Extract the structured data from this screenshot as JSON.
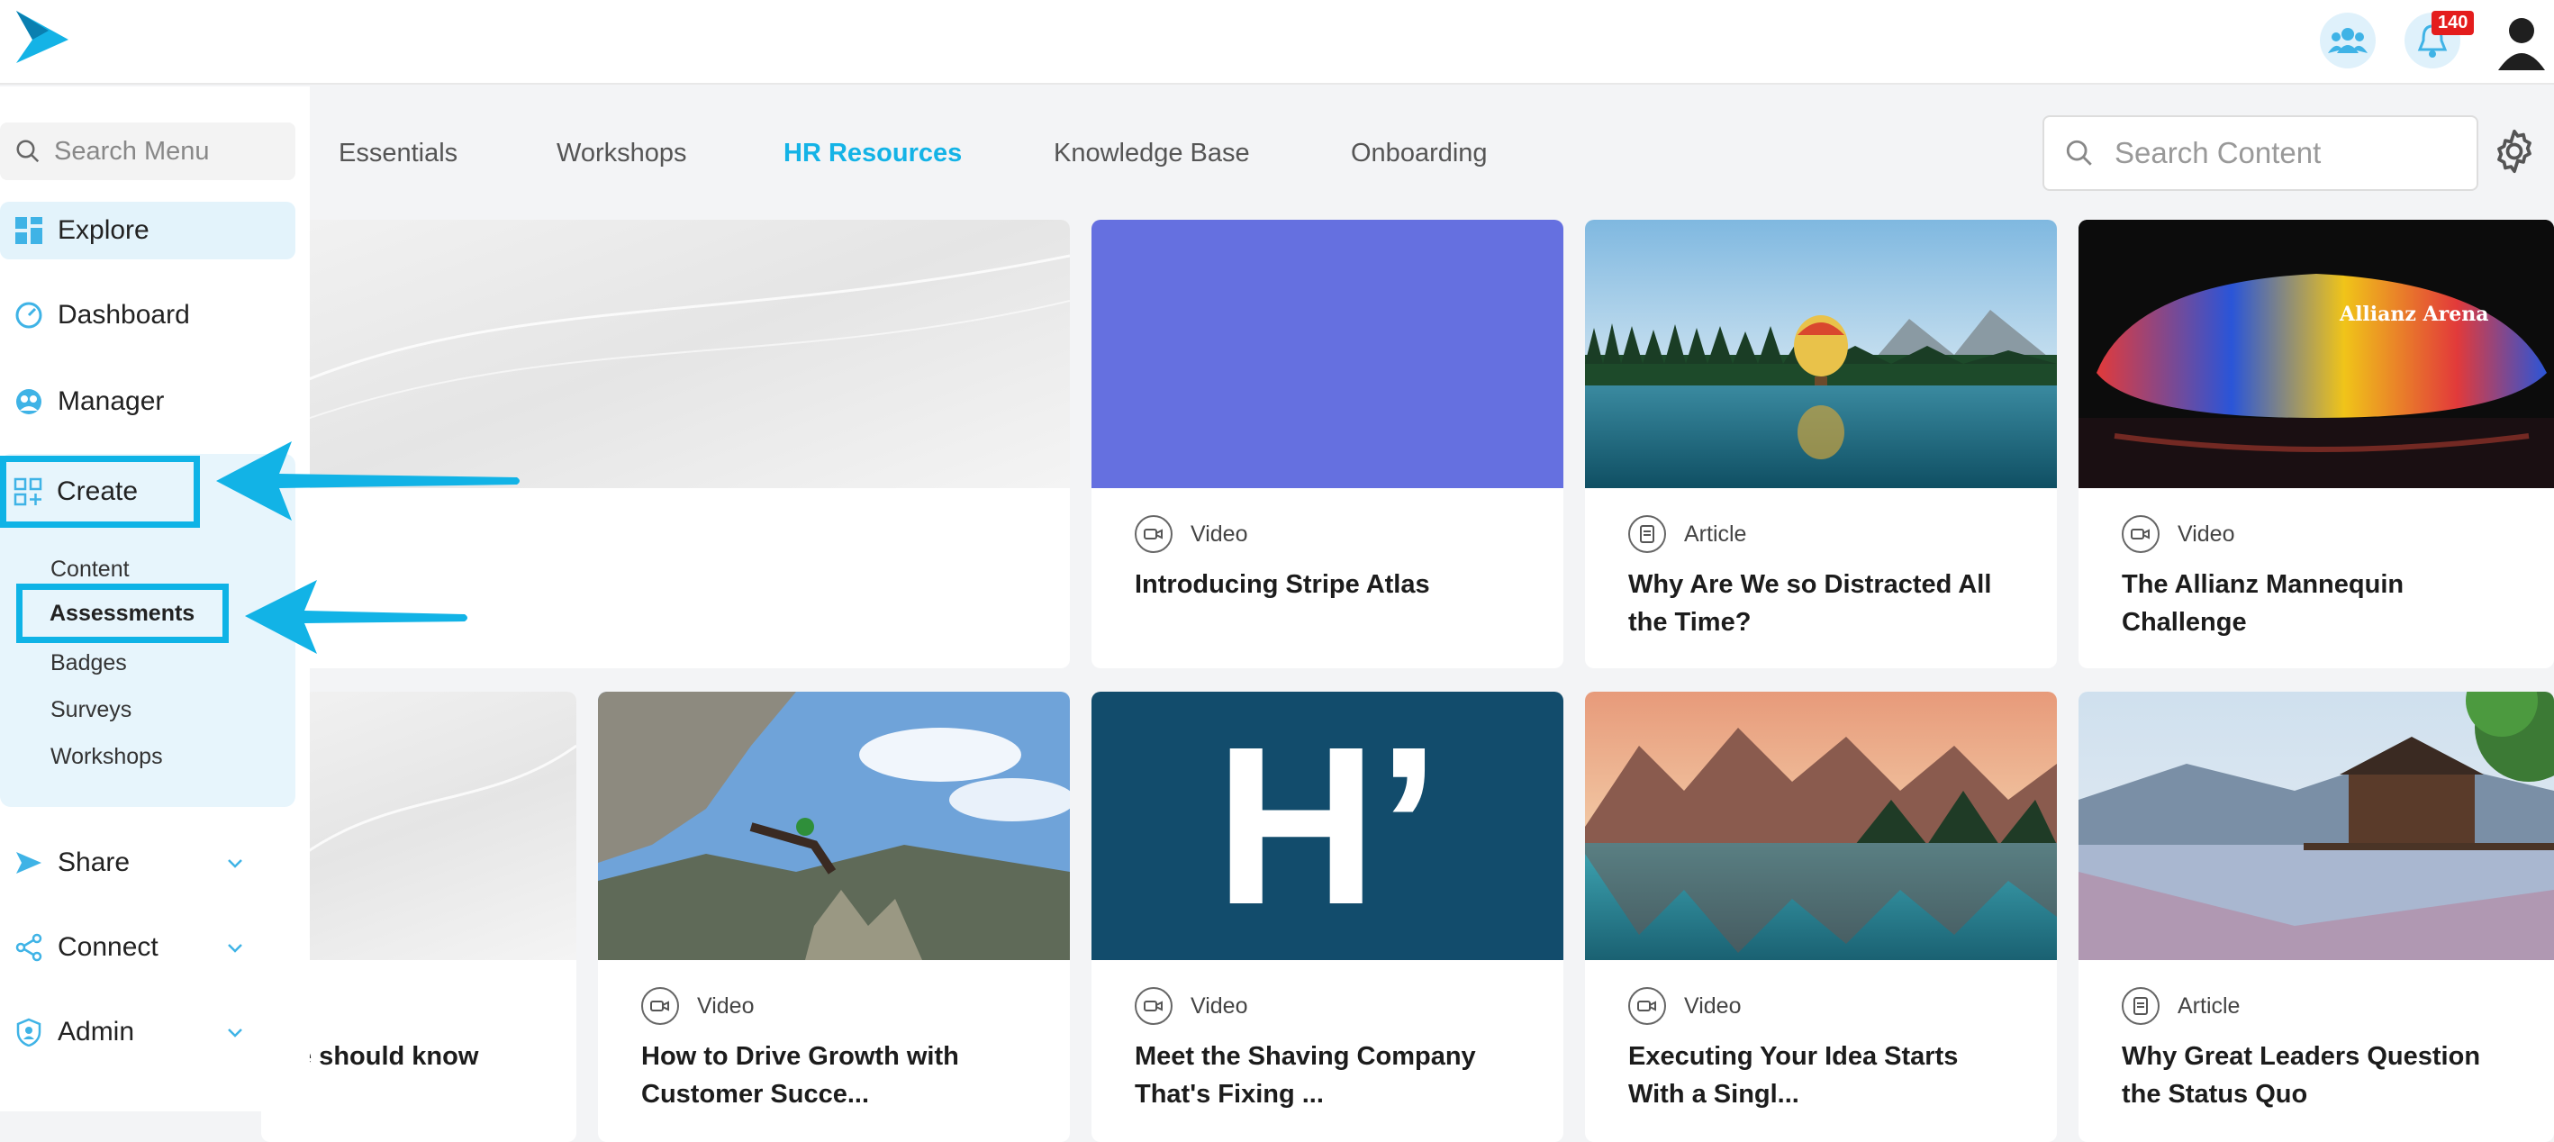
{
  "header": {
    "notification_count": "140"
  },
  "sidebar": {
    "search_placeholder": "Search Menu",
    "items": {
      "explore": "Explore",
      "dashboard": "Dashboard",
      "manager": "Manager",
      "create": "Create",
      "share": "Share",
      "connect": "Connect",
      "admin": "Admin"
    },
    "create_sub": {
      "content": "Content",
      "assessments": "Assessments",
      "badges": "Badges",
      "surveys": "Surveys",
      "workshops": "Workshops"
    }
  },
  "tabs": [
    "Essentials",
    "Workshops",
    "HR Resources",
    "Knowledge Base",
    "Onboarding"
  ],
  "active_tab": "HR Resources",
  "search_content_placeholder": "Search Content",
  "cards": [
    {
      "type": "Video",
      "title": "Introducing Stripe Atlas"
    },
    {
      "type": "Article",
      "title": "Why Are We so Distracted All the Time?"
    },
    {
      "type": "Video",
      "title": "The Allianz Mannequin Challenge"
    },
    {
      "type": "",
      "title": "e should know"
    },
    {
      "type": "Video",
      "title": "How to Drive Growth with Customer Succe..."
    },
    {
      "type": "Video",
      "title": "Meet the Shaving Company That's Fixing ..."
    },
    {
      "type": "Video",
      "title": "Executing Your Idea Starts With a Singl..."
    },
    {
      "type": "Article",
      "title": "Why Great Leaders Question the Status Quo"
    }
  ],
  "thumb_text": {
    "h_logo": "H’",
    "allianz": "Allianz Arena"
  },
  "colors": {
    "accent": "#14b3e6",
    "highlight": "#0fb3e6",
    "stripe": "#6570e0",
    "h_tile": "#124c6c"
  }
}
